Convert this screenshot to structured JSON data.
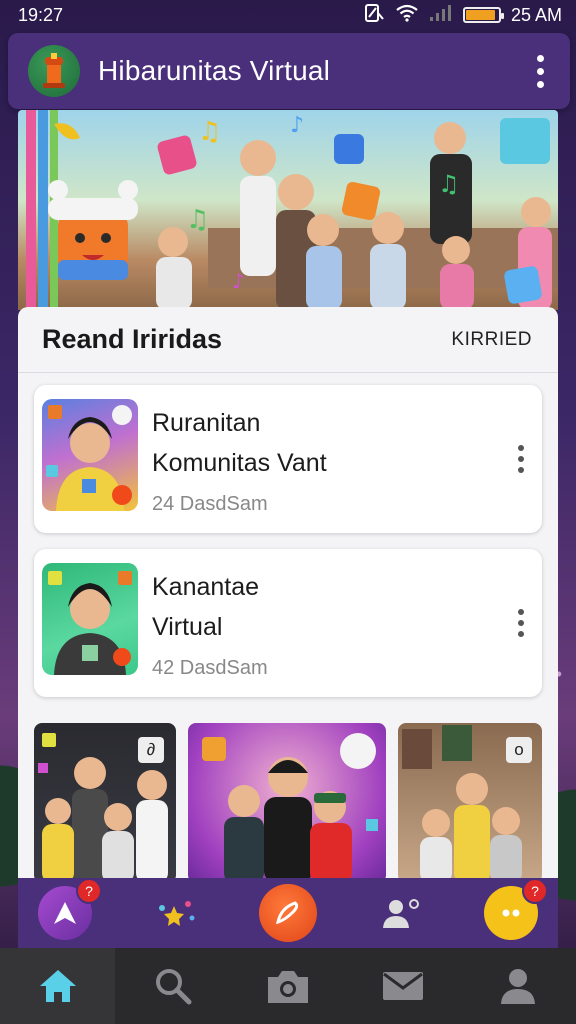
{
  "status_bar": {
    "time": "19:27",
    "battery_text": "25 AM",
    "battery_level": 0.9,
    "icons": [
      "nfc-icon",
      "wifi-icon",
      "signal-icon",
      "battery-icon"
    ]
  },
  "header": {
    "title": "Hibarunitas Virtual",
    "logo": "app-logo-icon",
    "menu_icon": "more-vertical-icon"
  },
  "section": {
    "title": "Reand Iriridas",
    "action_label": "KIRRIED"
  },
  "groups": [
    {
      "name_line1": "Ruranitan",
      "name_line2": "Komunitas Vant",
      "meta": "24  DasdSam",
      "thumb_color": "#f2c33a"
    },
    {
      "name_line1": "Kanantae",
      "name_line2": "Virtual",
      "meta": "42  DasdSam",
      "thumb_color": "#3cc88a"
    }
  ],
  "photos": [
    {
      "badge": "∂"
    },
    {
      "badge": ""
    },
    {
      "badge": "o"
    }
  ],
  "action_bar": {
    "items": [
      {
        "icon": "brand-a-icon",
        "badge": "?"
      },
      {
        "icon": "sparkles-icon",
        "badge": ""
      },
      {
        "icon": "pen-icon",
        "badge": ""
      },
      {
        "icon": "add-friend-icon",
        "badge": ""
      },
      {
        "icon": "chat-bubble-icon",
        "badge": "?"
      }
    ]
  },
  "bottom_nav": {
    "items": [
      "home-icon",
      "search-icon",
      "camera-icon",
      "mail-icon",
      "profile-icon"
    ],
    "active_color": "#5ad0e8",
    "inactive_color": "#8a8a8e"
  }
}
